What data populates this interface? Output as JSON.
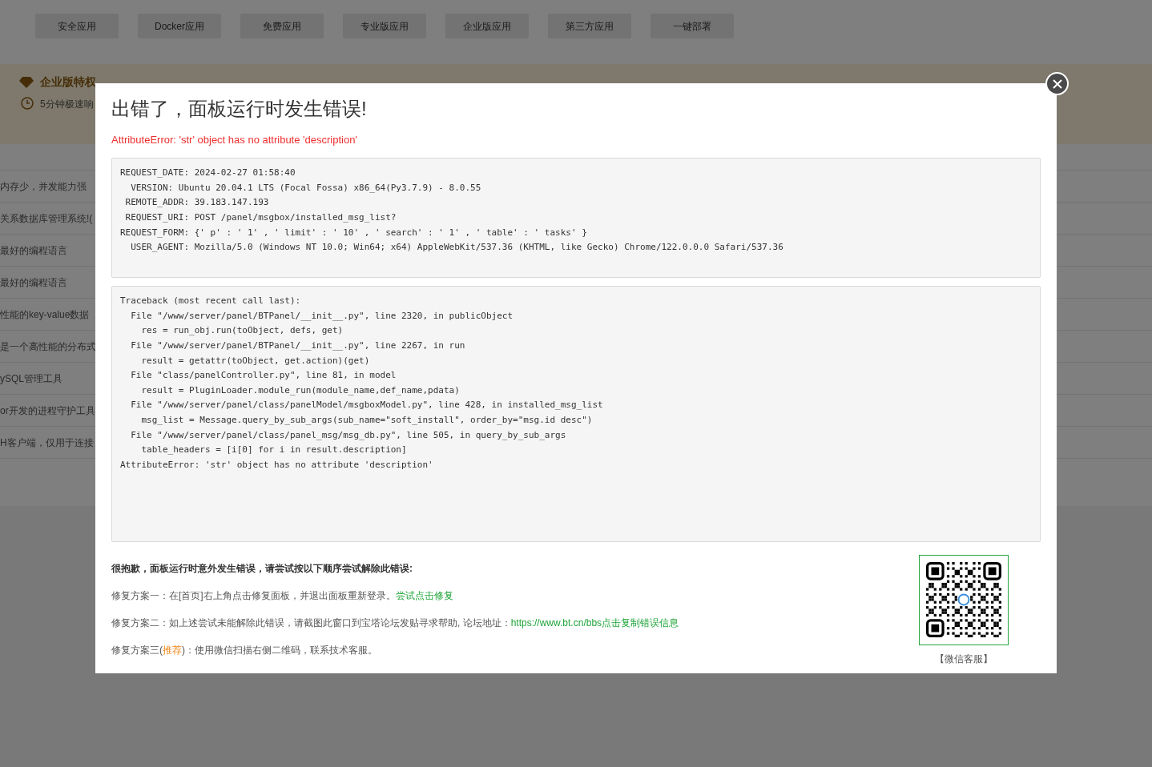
{
  "background": {
    "tabs": [
      "安全应用",
      "Docker应用",
      "免费应用",
      "专业版应用",
      "企业版应用",
      "第三方应用",
      "一键部署"
    ],
    "banner": {
      "title": "企业版特权",
      "note": "5分钟极速响"
    },
    "rows": [
      "内存少，并发能力强",
      "关系数据库管理系统!(",
      "最好的编程语言",
      "最好的编程语言",
      "性能的key-value数据",
      "是一个高性能的分布式",
      "ySQL管理工具",
      "or开发的进程守护工具",
      "H客户端，仅用于连接"
    ]
  },
  "modal": {
    "title": "出错了，面板运行时发生错误!",
    "error": "AttributeError: 'str' object has no attribute 'description'",
    "request_info": [
      "REQUEST_DATE: 2024-02-27 01:58:40",
      "  VERSION: Ubuntu 20.04.1 LTS (Focal Fossa) x86_64(Py3.7.9) - 8.0.55",
      " REMOTE_ADDR: 39.183.147.193",
      " REQUEST_URI: POST /panel/msgbox/installed_msg_list?",
      "REQUEST_FORM: {' p' : ' 1' , ' limit' : ' 10' , ' search' : ' 1' , ' table' : ' tasks' }",
      "  USER_AGENT: Mozilla/5.0 (Windows NT 10.0; Win64; x64) AppleWebKit/537.36 (KHTML, like Gecko) Chrome/122.0.0.0 Safari/537.36"
    ],
    "traceback": [
      "Traceback (most recent call last):",
      "  File \"/www/server/panel/BTPanel/__init__.py\", line 2320, in publicObject",
      "    res = run_obj.run(toObject, defs, get)",
      "  File \"/www/server/panel/BTPanel/__init__.py\", line 2267, in run",
      "    result = getattr(toObject, get.action)(get)",
      "  File \"class/panelController.py\", line 81, in model",
      "    result = PluginLoader.module_run(module_name,def_name,pdata)",
      "  File \"/www/server/panel/class/panelModel/msgboxModel.py\", line 428, in installed_msg_list",
      "    msg_list = Message.query_by_sub_args(sub_name=\"soft_install\", order_by=\"msg.id desc\")",
      "  File \"/www/server/panel/class/panel_msg/msg_db.py\", line 505, in query_by_sub_args",
      "    table_headers = [i[0] for i in result.description]",
      "AttributeError: 'str' object has no attribute 'description'"
    ],
    "help": {
      "heading": "很抱歉，面板运行时意外发生错误，请尝试按以下顺序尝试解除此错误:",
      "solutions": [
        [
          {
            "kind": "text",
            "text": "修复方案一：在[首页]右上角点击修复面板，并退出面板重新登录。"
          },
          {
            "kind": "link",
            "text": "尝试点击修复"
          }
        ],
        [
          {
            "kind": "text",
            "text": "修复方案二：如上述尝试未能解除此错误，请截图此窗口到宝塔论坛发贴寻求帮助, 论坛地址："
          },
          {
            "kind": "link",
            "text": "https://www.bt.cn/bbs"
          },
          {
            "kind": "link",
            "text": "点击复制错误信息"
          }
        ],
        [
          {
            "kind": "text",
            "text": "修复方案三("
          },
          {
            "kind": "highlight",
            "text": "推荐"
          },
          {
            "kind": "text",
            "text": ")：使用微信扫描右侧二维码，联系技术客服。"
          }
        ]
      ]
    },
    "qr": {
      "caption": "【微信客服】"
    }
  }
}
